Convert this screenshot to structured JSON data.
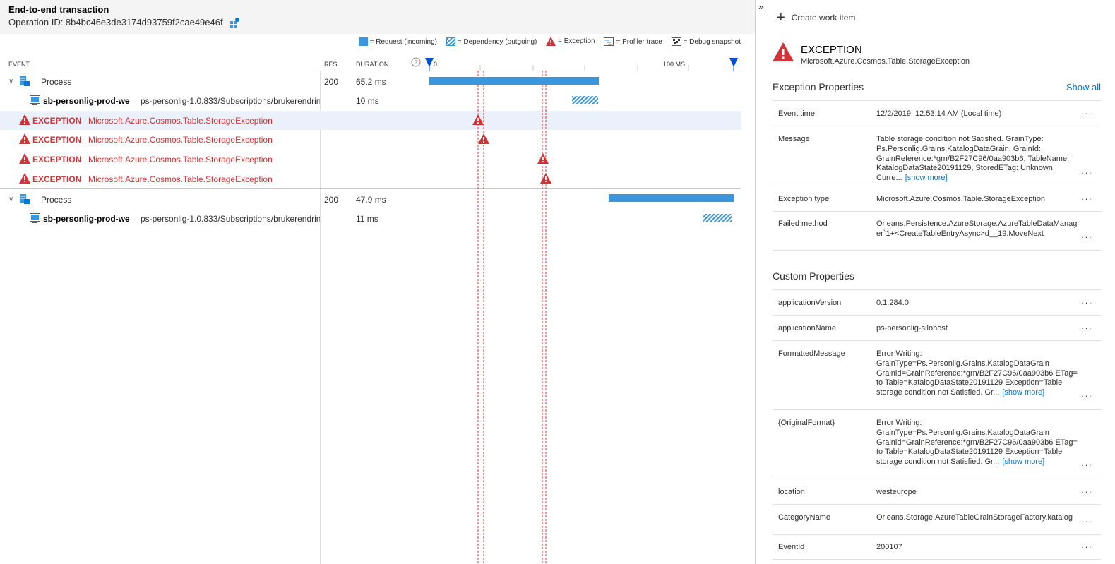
{
  "header": {
    "title": "End-to-end transaction",
    "operation_id": "Operation ID: 8b4bc46e3de3174d93759f2cae49e46f"
  },
  "legend": [
    {
      "label": "= Request (incoming)",
      "kind": "request"
    },
    {
      "label": "= Dependency (outgoing)",
      "kind": "dependency"
    },
    {
      "label": "= Exception",
      "kind": "exception"
    },
    {
      "label": "= Profiler trace",
      "kind": "profiler"
    },
    {
      "label": "= Debug snapshot",
      "kind": "snapshot"
    }
  ],
  "columns": {
    "event": "EVENT",
    "res": "RES.",
    "duration": "DURATION",
    "tick_0": "0",
    "tick_100": "100 MS"
  },
  "rows": [
    {
      "type": "process",
      "name": "Process",
      "res": "200",
      "duration": "65.2 ms"
    },
    {
      "type": "dependency",
      "name": "sb-personlig-prod-we",
      "detail": "ps-personlig-1.0.833/Subscriptions/brukerendrin",
      "duration": "10 ms"
    },
    {
      "type": "exception",
      "label": "EXCEPTION",
      "detail": "Microsoft.Azure.Cosmos.Table.StorageException"
    },
    {
      "type": "exception",
      "label": "EXCEPTION",
      "detail": "Microsoft.Azure.Cosmos.Table.StorageException"
    },
    {
      "type": "exception",
      "label": "EXCEPTION",
      "detail": "Microsoft.Azure.Cosmos.Table.StorageException"
    },
    {
      "type": "exception",
      "label": "EXCEPTION",
      "detail": "Microsoft.Azure.Cosmos.Table.StorageException"
    },
    {
      "type": "process",
      "name": "Process",
      "res": "200",
      "duration": "47.9 ms"
    },
    {
      "type": "dependency",
      "name": "sb-personlig-prod-we",
      "detail": "ps-personlig-1.0.833/Subscriptions/brukerendrin",
      "duration": "11 ms"
    }
  ],
  "colors": {
    "accent": "#0078d4",
    "bar": "#3a96dd",
    "exception": "#d13438"
  },
  "side": {
    "create_work_item": "Create work item",
    "exception_title": "EXCEPTION",
    "exception_type": "Microsoft.Azure.Cosmos.Table.StorageException",
    "exception_props_title": "Exception Properties",
    "show_all": "Show all",
    "custom_props_title": "Custom Properties",
    "show_more": "[show more]",
    "more_icon": "···",
    "exception_props": [
      {
        "key": "Event time",
        "value": "12/2/2019, 12:53:14 AM (Local time)"
      },
      {
        "key": "Message",
        "value": "Table storage condition not Satisfied. GrainType: Ps.Personlig.Grains.KatalogDataGrain, GrainId: GrainReference:*grn/B2F27C96/0aa903b6, TableName: KatalogDataState20191129, StoredETag: Unknown, Curre...",
        "show_more": true
      },
      {
        "key": "Exception type",
        "value": "Microsoft.Azure.Cosmos.Table.StorageException"
      },
      {
        "key": "Failed method",
        "value": "Orleans.Persistence.AzureStorage.AzureTableDataManager`1+<CreateTableEntryAsync>d__19.MoveNext"
      }
    ],
    "custom_props": [
      {
        "key": "applicationVersion",
        "value": "0.1.284.0"
      },
      {
        "key": "applicationName",
        "value": "ps-personlig-silohost"
      },
      {
        "key": "FormattedMessage",
        "value": "Error Writing: GrainType=Ps.Personlig.Grains.KatalogDataGrain Grainid=GrainReference:*grn/B2F27C96/0aa903b6 ETag= to Table=KatalogDataState20191129 Exception=Table storage condition not Satisfied. Gr...",
        "show_more": true
      },
      {
        "key": "{OriginalFormat}",
        "value": "Error Writing: GrainType=Ps.Personlig.Grains.KatalogDataGrain Grainid=GrainReference:*grn/B2F27C96/0aa903b6 ETag= to Table=KatalogDataState20191129 Exception=Table storage condition not Satisfied. Gr...",
        "show_more": true
      },
      {
        "key": "location",
        "value": "westeurope"
      },
      {
        "key": "CategoryName",
        "value": "Orleans.Storage.AzureTableGrainStorageFactory.katalog"
      },
      {
        "key": "EventId",
        "value": "200107"
      }
    ]
  }
}
